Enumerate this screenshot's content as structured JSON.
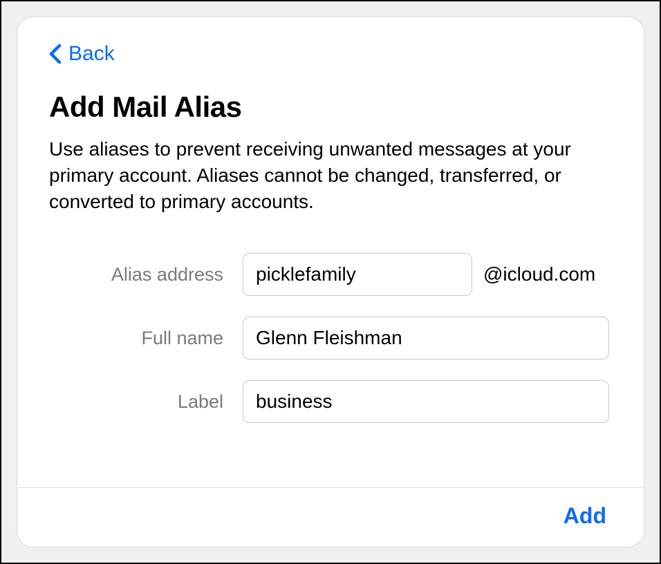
{
  "colors": {
    "accent": "#0b6bf2"
  },
  "header": {
    "back_label": "Back",
    "title": "Add Mail Alias",
    "description": "Use aliases to prevent receiving unwanted messages at your primary account. Aliases cannot be changed, transferred, or converted to primary accounts."
  },
  "form": {
    "alias": {
      "label": "Alias address",
      "value": "picklefamily",
      "domain_suffix": "@icloud.com"
    },
    "fullname": {
      "label": "Full name",
      "value": "Glenn Fleishman"
    },
    "labelfield": {
      "label": "Label",
      "value": "business"
    }
  },
  "footer": {
    "add_label": "Add"
  }
}
